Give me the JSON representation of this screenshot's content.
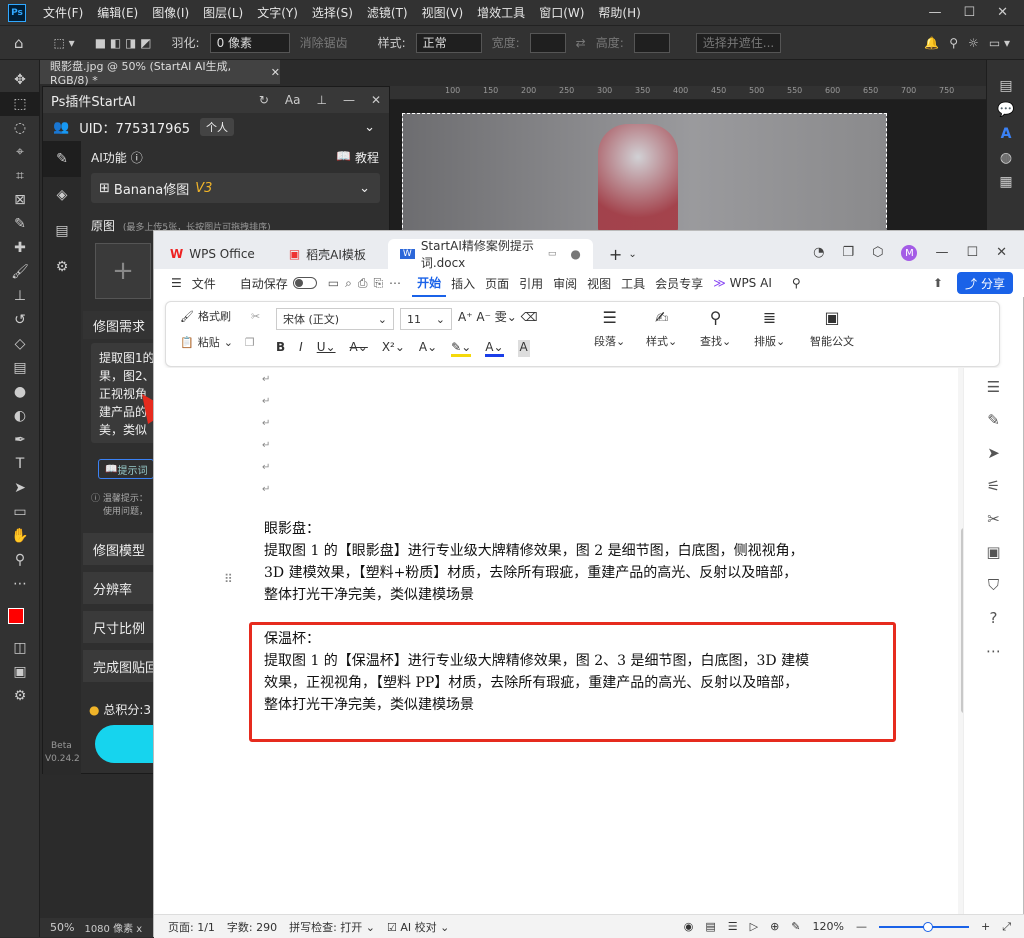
{
  "ps": {
    "logo": "Ps",
    "menu": [
      "文件(F)",
      "编辑(E)",
      "图像(I)",
      "图层(L)",
      "文字(Y)",
      "选择(S)",
      "滤镜(T)",
      "视图(V)",
      "增效工具",
      "窗口(W)",
      "帮助(H)"
    ],
    "options": {
      "feather_label": "羽化:",
      "feather_value": "0 像素",
      "antialias": "消除锯齿",
      "style_label": "样式:",
      "style_value": "正常",
      "width_label": "宽度:",
      "height_label": "高度:",
      "select_subject": "选择并遮住..."
    },
    "doc_tab": "眼影盘.jpg @ 50% (StartAI AI生成, RGB/8) *",
    "ruler_ticks": [
      "100",
      "150",
      "200",
      "250",
      "300",
      "350",
      "400",
      "450",
      "500",
      "550",
      "600",
      "650",
      "700",
      "750"
    ],
    "status_zoom": "50%",
    "status_size": "1080 像素 x"
  },
  "plugin": {
    "title": "Ps插件StartAI",
    "uid": "UID：775317965",
    "account": "个人",
    "ai_func": "AI功能",
    "tutorial": "教程",
    "model_select": "Banana修图",
    "model_version": "V3",
    "original_label": "原图",
    "original_hint": "(最多上传5张，长按图片可拖拽排序)",
    "need_label": "修图需求",
    "need_text": [
      "提取图1的",
      "果，图2、",
      "正视视角",
      "建产品的",
      "美，类似"
    ],
    "prompt_btn": "提示词",
    "tip_line1": "温馨提示：",
    "tip_line2": "使用问题，",
    "model_label": "修图模型",
    "resolution_label": "分辨率",
    "ratio_label": "尺寸比例",
    "paste_label": "完成图贴回",
    "points_label": "总积分:3",
    "beta": "Beta",
    "version": "V0.24.2"
  },
  "wps": {
    "tabs": [
      {
        "label": "WPS Office"
      },
      {
        "label": "稻壳AI模板"
      },
      {
        "label": "StartAI精修案例提示词.docx"
      }
    ],
    "menu": [
      "文件",
      "自动保存",
      "开始",
      "插入",
      "页面",
      "引用",
      "审阅",
      "视图",
      "工具",
      "会员专享",
      "WPS AI"
    ],
    "share": "分享",
    "ribbon": {
      "format_brush": "格式刷",
      "paste": "粘贴",
      "font": "宋体 (正文)",
      "size": "11",
      "paragraph": "段落",
      "style": "样式",
      "find": "查找",
      "layout": "排版",
      "smart_doc": "智能公文"
    },
    "doc": {
      "p1_title": "眼影盘：",
      "p1_lines": [
        "提取图 1 的【眼影盘】进行专业级大牌精修效果，图 2 是细节图，白底图，侧视视角，",
        "3D 建模效果，【塑料+粉质】材质，去除所有瑕疵，重建产品的高光、反射以及暗部，",
        "整体打光干净完美，类似建模场景"
      ],
      "p2_title": "保温杯：",
      "p2_lines": [
        "提取图 1 的【保温杯】进行专业级大牌精修效果，图 2、3 是细节图，白底图，3D 建模",
        "效果，正视视角，【塑料 PP】材质，去除所有瑕疵，重建产品的高光、反射以及暗部，",
        "整体打光干净完美，类似建模场景"
      ]
    },
    "status": {
      "page": "页面: 1/1",
      "words": "字数: 290",
      "spell": "拼写检查: 打开",
      "ai": "AI 校对",
      "zoom": "120%"
    }
  },
  "colors": {
    "accent_red": "#e62b1e",
    "wps_blue": "#1a62e8",
    "ps_dark": "#323232"
  }
}
